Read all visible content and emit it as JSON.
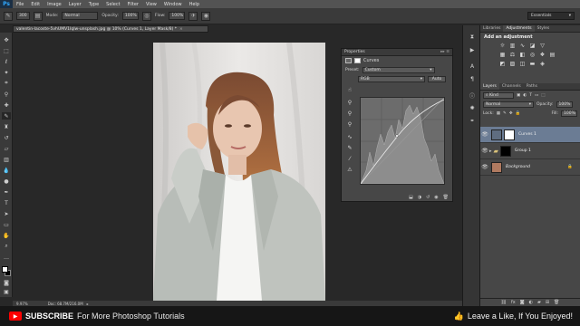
{
  "menubar": {
    "logo": "Ps",
    "items": [
      "File",
      "Edit",
      "Image",
      "Layer",
      "Type",
      "Select",
      "Filter",
      "View",
      "Window",
      "Help"
    ]
  },
  "options": {
    "brush_size": "300",
    "mode_label": "Mode:",
    "mode_value": "Normal",
    "opacity_label": "Opacity:",
    "opacity_value": "100%",
    "flow_label": "Flow:",
    "flow_value": "100%",
    "workspace": "Essentials"
  },
  "document": {
    "tab_title": "valentin-lacoste-5vhUMV1IqIw-unsplash.jpg @ 10% (Curves 1, Layer Mask/8) *",
    "zoom": "9.97%",
    "doc_info": "Doc: 68.7M/216.0M"
  },
  "properties": {
    "title": "Properties",
    "panel_name": "Curves",
    "preset_label": "Preset:",
    "preset_value": "Custom",
    "channel_value": "RGB",
    "auto_label": "Auto"
  },
  "adjustments": {
    "tabs": [
      "Libraries",
      "Adjustments",
      "Styles"
    ],
    "active_tab": "Adjustments",
    "heading": "Add an adjustment"
  },
  "layers": {
    "tabs": [
      "Layers",
      "Channels",
      "Paths"
    ],
    "active_tab": "Layers",
    "filter_kind": "Kind",
    "blend_mode": "Normal",
    "opacity_label": "Opacity:",
    "opacity_value": "100%",
    "lock_label": "Lock:",
    "fill_label": "Fill:",
    "fill_value": "100%",
    "items": [
      {
        "name": "Curves 1",
        "selected": true
      },
      {
        "name": "Group 1",
        "selected": false
      },
      {
        "name": "Background",
        "selected": false
      }
    ]
  },
  "banner": {
    "subscribe": "SUBSCRIBE",
    "subscribe_text": "For More Photoshop Tutorials",
    "like_text": "Leave a Like, If You Enjoyed!"
  },
  "colors": {
    "accent": "#31a8ff",
    "selected_layer": "#6b7c94",
    "subscribe_red": "#ff0000"
  }
}
